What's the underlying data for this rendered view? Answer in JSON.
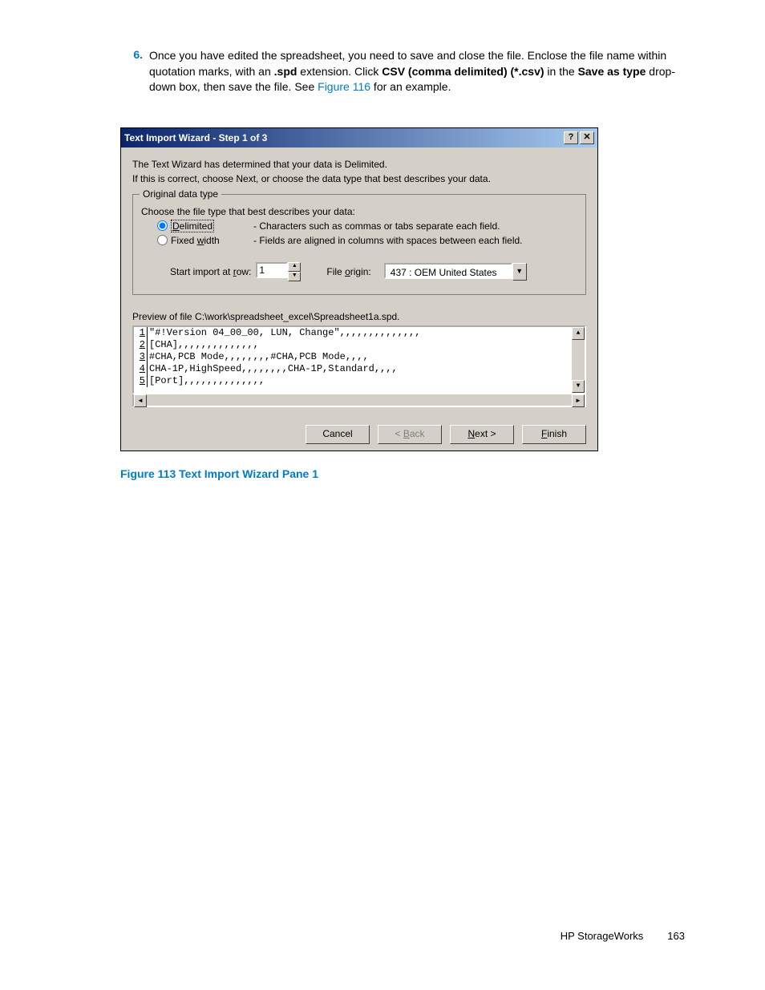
{
  "step": {
    "number": "6.",
    "text_1": "Once you have edited the spreadsheet, you need to save and close the file. Enclose the file name within quotation marks, with an ",
    "bold_1": ".spd",
    "text_2": " extension. Click ",
    "bold_2": "CSV (comma delimited) (*.csv)",
    "text_3": " in the ",
    "bold_3": "Save as type",
    "text_4": " drop-down box, then save the file. See ",
    "link": "Figure 116",
    "text_5": " for an example."
  },
  "dialog": {
    "title": "Text Import Wizard - Step 1 of 3",
    "help_btn": "?",
    "close_btn": "✕",
    "intro_1": "The Text Wizard has determined that your data is Delimited.",
    "intro_2": "If this is correct, choose Next, or choose the data type that best describes your data.",
    "fieldset_legend": "Original data type",
    "fieldset_prompt": "Choose the file type that best describes your data:",
    "radio_delim_pre": "D",
    "radio_delim_rest": "elimited",
    "radio_delim_desc": "- Characters such as commas or tabs separate each field.",
    "radio_fixed_pre": "Fixed ",
    "radio_fixed_u": "w",
    "radio_fixed_post": "idth",
    "radio_fixed_desc": "- Fields are aligned in columns with spaces between each field.",
    "start_row_pre": "Start import at ",
    "start_row_u": "r",
    "start_row_post": "ow:",
    "start_row_value": "1",
    "file_origin_pre": "File ",
    "file_origin_u": "o",
    "file_origin_post": "rigin:",
    "file_origin_value": "437 : OEM United States",
    "preview_label": "Preview of file C:\\work\\spreadsheet_excel\\Spreadsheet1a.spd.",
    "preview_lines": [
      {
        "n": "1",
        "t": "\"#!Version 04_00_00, LUN, Change\",,,,,,,,,,,,,,"
      },
      {
        "n": "2",
        "t": "[CHA],,,,,,,,,,,,,,"
      },
      {
        "n": "3",
        "t": "#CHA,PCB Mode,,,,,,,,#CHA,PCB Mode,,,,"
      },
      {
        "n": "4",
        "t": "CHA-1P,HighSpeed,,,,,,,,CHA-1P,Standard,,,,"
      },
      {
        "n": "5",
        "t": "[Port],,,,,,,,,,,,,,"
      }
    ],
    "btn_cancel": "Cancel",
    "btn_back_lt": "< ",
    "btn_back_u": "B",
    "btn_back_rest": "ack",
    "btn_next_u": "N",
    "btn_next_rest": "ext >",
    "btn_finish_u": "F",
    "btn_finish_rest": "inish"
  },
  "figure_caption": "Figure 113 Text Import Wizard Pane 1",
  "footer": {
    "product": "HP StorageWorks",
    "page": "163"
  }
}
